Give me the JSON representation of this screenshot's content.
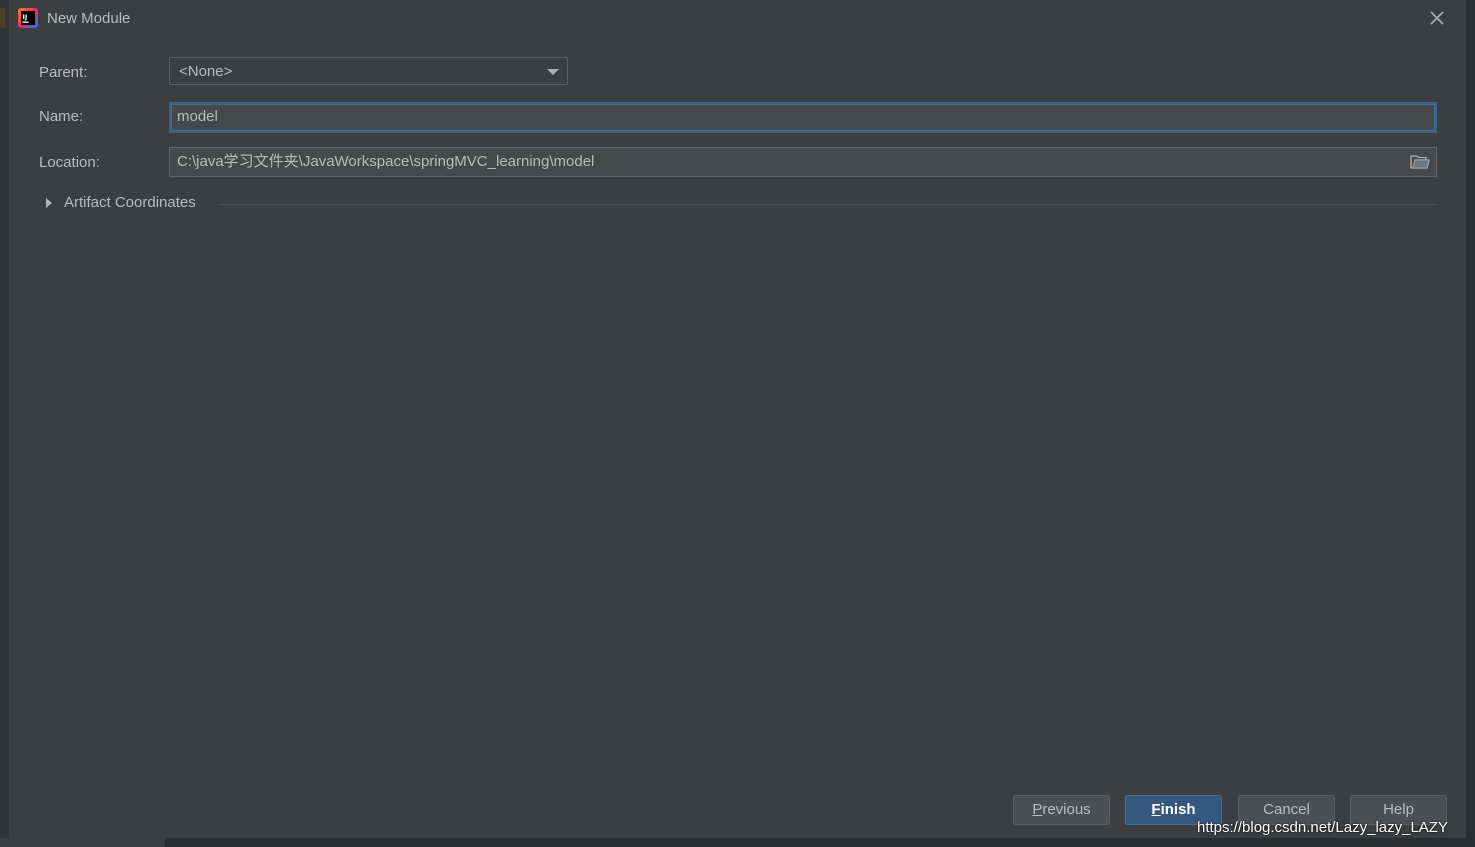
{
  "window": {
    "title": "New Module"
  },
  "form": {
    "parent": {
      "label": "Parent:",
      "value": "<None>"
    },
    "name": {
      "label": "Name:",
      "value": "model"
    },
    "location": {
      "label": "Location:",
      "value": "C:\\java学习文件夹\\JavaWorkspace\\springMVC_learning\\model"
    },
    "artifact": {
      "label": "Artifact Coordinates",
      "expanded": false
    }
  },
  "buttons": {
    "previous": {
      "mnemonic": "P",
      "rest": "revious"
    },
    "finish": {
      "mnemonic": "F",
      "rest": "inish"
    },
    "cancel": "Cancel",
    "help": "Help"
  },
  "watermark": "https://blog.csdn.net/Lazy_lazy_LAZY",
  "colors": {
    "background": "#3c3f41",
    "text": "#bbbbbb",
    "focus_border": "#3d6185",
    "primary_button": "#365880"
  },
  "icons": {
    "app": "intellij-icon",
    "close": "close-icon",
    "dropdown": "chevron-down-icon",
    "browse": "folder-icon",
    "expand": "chevron-right-icon"
  }
}
